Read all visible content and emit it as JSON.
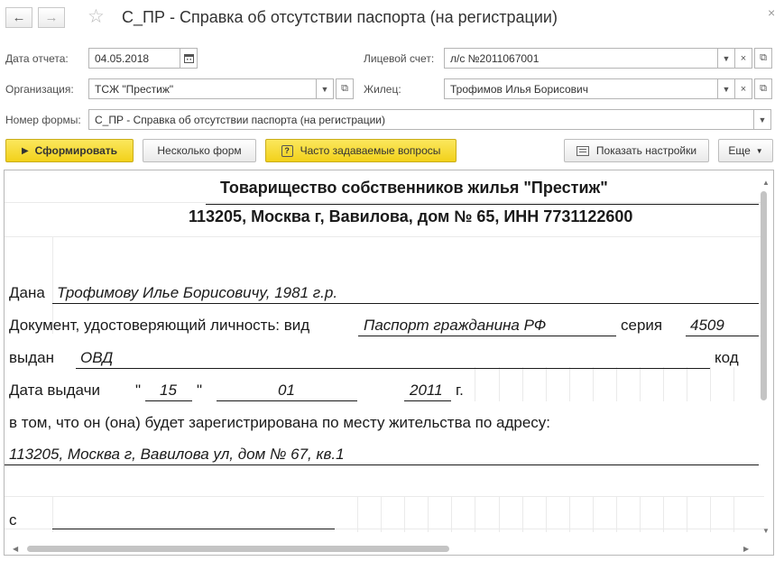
{
  "window": {
    "title": "С_ПР - Справка об отсутствии паспорта (на регистрации)",
    "back_icon": "←",
    "forward_icon": "→",
    "favorite_icon": "☆",
    "close_icon": "×"
  },
  "form": {
    "report_date": {
      "label": "Дата отчета:",
      "value": "04.05.2018"
    },
    "organization": {
      "label": "Организация:",
      "value": "ТСЖ \"Престиж\""
    },
    "account": {
      "label": "Лицевой счет:",
      "value": "л/с №2011067001"
    },
    "resident": {
      "label": "Жилец:",
      "value": "Трофимов Илья Борисович"
    },
    "form_number": {
      "label": "Номер формы:",
      "value": "С_ПР - Справка об отсутствии паспорта (на регистрации)"
    }
  },
  "toolbar": {
    "generate": "Сформировать",
    "several_forms": "Несколько форм",
    "faq": "Часто задаваемые вопросы",
    "faq_icon": "?",
    "show_settings": "Показать настройки",
    "more": "Еще"
  },
  "report": {
    "org_name": "Товарищество собственников жилья \"Престиж\"",
    "org_address": "113205, Москва г, Вавилова, дом № 65, ИНН 7731122600",
    "issued_to_label": "Дана",
    "issued_to_value": "Трофимову Илье Борисовичу, 1981 г.р.",
    "doc_label": "Документ, удостоверяющий личность: вид",
    "doc_type": "Паспорт гражданина РФ",
    "series_label": "серия",
    "series_value": "4509",
    "issued_by_label": "выдан",
    "issued_by_value": "ОВД",
    "code_label": "код",
    "issue_date_label": "Дата выдачи",
    "quote_open": "\"",
    "day": "15",
    "quote_close": "\"",
    "month": "01",
    "year": "2011",
    "year_suffix": "г.",
    "reg_statement": "в том, что он (она) будет зарегистрирована по месту жительства по адресу:",
    "address": "113205, Москва г, Вавилова ул, дом № 67, кв.1",
    "from_label": "с"
  }
}
